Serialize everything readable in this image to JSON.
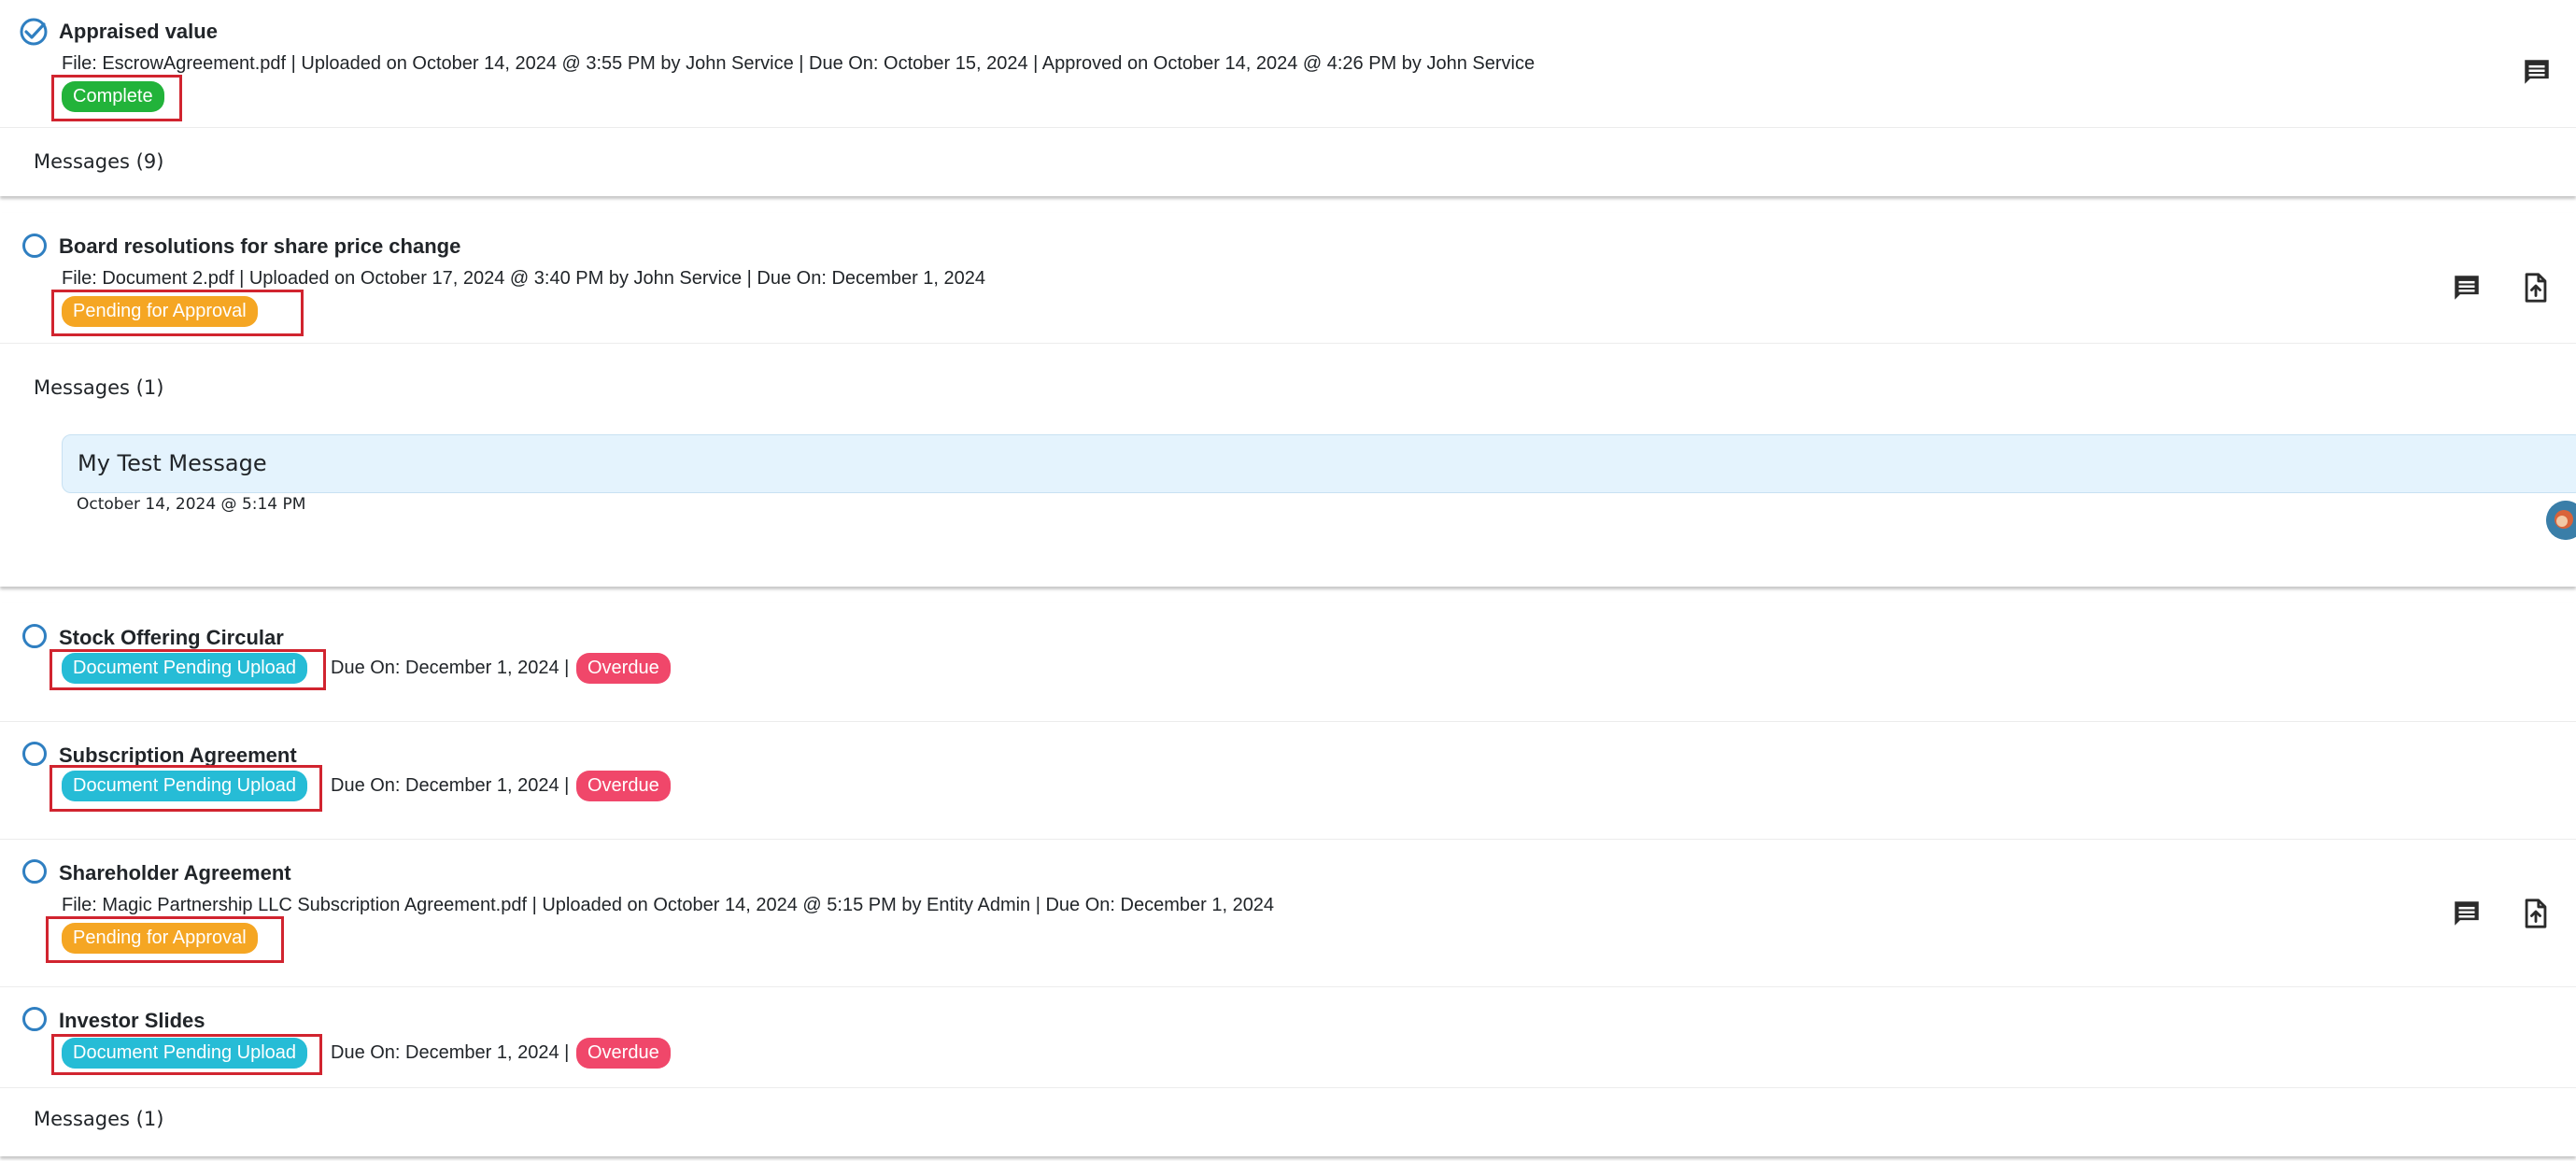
{
  "tasks": [
    {
      "title": "Appraised value",
      "meta": "File: EscrowAgreement.pdf | Uploaded on October 14, 2024 @ 3:55 PM by John Service | Due On: October 15, 2024 | Approved on October 14, 2024 @ 4:26 PM by John Service",
      "status": "Complete",
      "messages_label": "Messages (9)"
    },
    {
      "title": "Board resolutions for share price change",
      "meta": "File: Document 2.pdf | Uploaded on October 17, 2024 @ 3:40 PM by John Service | Due On: December 1, 2024",
      "status": "Pending for Approval",
      "messages_label": "Messages (1)",
      "message": {
        "text": "My Test Message",
        "date": "October 14, 2024 @ 5:14 PM"
      }
    },
    {
      "title": "Stock Offering Circular",
      "status": "Document Pending Upload",
      "due": "Due On: December 1, 2024 |",
      "overdue": "Overdue"
    },
    {
      "title": "Subscription Agreement",
      "status": "Document Pending Upload",
      "due": "Due On: December 1, 2024 |",
      "overdue": "Overdue"
    },
    {
      "title": "Shareholder Agreement",
      "meta": "File: Magic Partnership LLC Subscription Agreement.pdf | Uploaded on October 14, 2024 @ 5:15 PM by Entity Admin | Due On: December 1, 2024",
      "status": "Pending for Approval"
    },
    {
      "title": "Investor Slides",
      "status": "Document Pending Upload",
      "due": "Due On: December 1, 2024 |",
      "overdue": "Overdue",
      "messages_label": "Messages (1)"
    }
  ],
  "colors": {
    "complete": "#22b33a",
    "pending_approval": "#f5a623",
    "pending_upload": "#26bcd6",
    "overdue": "#f0476a",
    "highlight_box": "#d1242f",
    "circle_accent": "#2f7fc1"
  },
  "icons": {
    "complete_status": "check-circle-icon",
    "open_status": "circle-icon",
    "comment": "comment-icon",
    "upload": "file-upload-icon"
  }
}
